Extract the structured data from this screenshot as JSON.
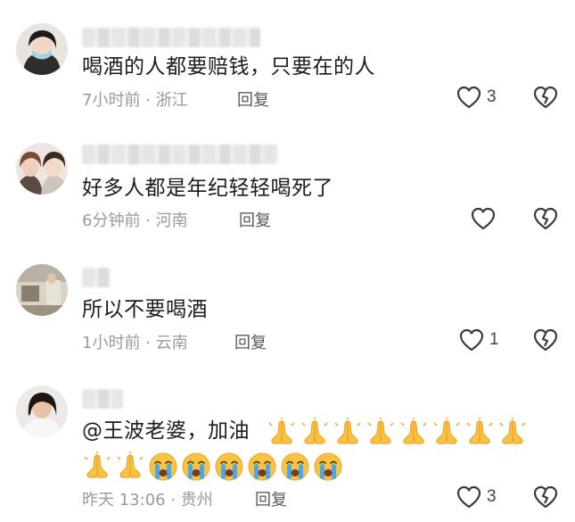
{
  "comments": [
    {
      "text": "喝酒的人都要赔钱，只要在的人",
      "time_location": "7小时前 · 浙江",
      "reply_label": "回复",
      "likes": "3",
      "avatar": "avatar-woman-mask"
    },
    {
      "text": "好多人都是年纪轻轻喝死了",
      "time_location": "6分钟前 · 河南",
      "reply_label": "回复",
      "likes": "",
      "avatar": "avatar-two-women"
    },
    {
      "text": "所以不要喝酒",
      "time_location": "1小时前 · 云南",
      "reply_label": "回复",
      "likes": "1",
      "avatar": "avatar-room-scene"
    },
    {
      "text": "@王波老婆，加油",
      "time_location": "昨天 13:06 · 贵州",
      "reply_label": "回复",
      "likes": "3",
      "avatar": "avatar-woman-dark-hair",
      "emojis_line1": [
        "praying-hands",
        "praying-hands",
        "praying-hands",
        "praying-hands",
        "praying-hands",
        "praying-hands",
        "praying-hands",
        "praying-hands"
      ],
      "emojis_line2": [
        "praying-hands",
        "praying-hands",
        "crying-face",
        "crying-face",
        "crying-face",
        "crying-face",
        "crying-face",
        "crying-face"
      ]
    }
  ],
  "icons": {
    "like": "heart-outline-icon",
    "dislike": "broken-heart-icon"
  },
  "colors": {
    "text": "#1c1c1c",
    "meta": "#9a9a9a",
    "reply": "#5a5a5a",
    "icon": "#3a3a3a",
    "emoji_yellow": "#f6c342",
    "emoji_orange": "#f0a32c",
    "tear_blue": "#4aa8e8"
  }
}
